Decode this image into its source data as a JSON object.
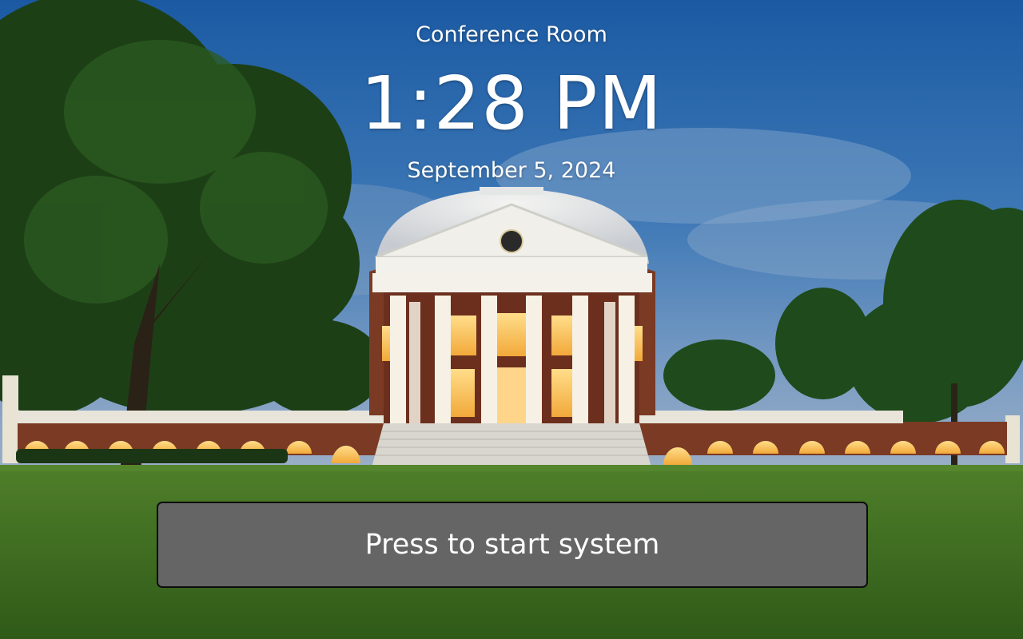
{
  "room": {
    "name": "Conference Room"
  },
  "clock": {
    "time": "1:28 PM",
    "date": "September 5, 2024"
  },
  "start": {
    "label": "Press to start system"
  },
  "colors": {
    "button_bg": "#656565",
    "button_border": "#0d0d0d",
    "text": "#ffffff",
    "sky_top": "#1c5fa8",
    "lawn": "#3f6f22"
  }
}
